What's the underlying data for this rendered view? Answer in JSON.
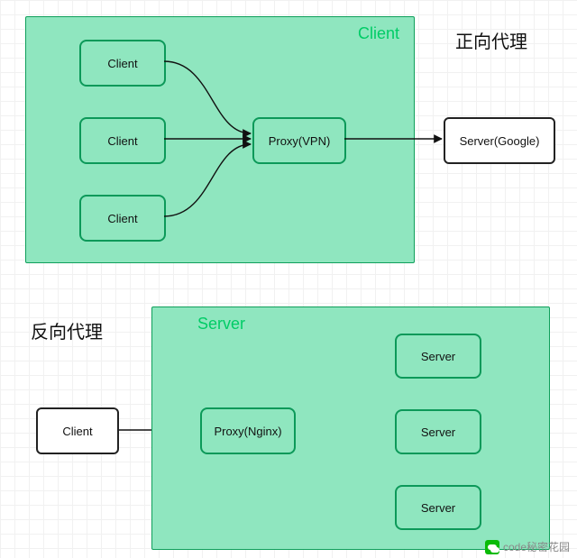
{
  "forward": {
    "heading": "正向代理",
    "groupTitle": "Client",
    "clients": [
      "Client",
      "Client",
      "Client"
    ],
    "proxy": "Proxy(VPN)",
    "server": "Server(Google)"
  },
  "reverse": {
    "heading": "反向代理",
    "groupTitle": "Server",
    "client": "Client",
    "proxy": "Proxy(Nginx)",
    "servers": [
      "Server",
      "Server",
      "Server"
    ]
  },
  "watermark": "code秘密花园"
}
